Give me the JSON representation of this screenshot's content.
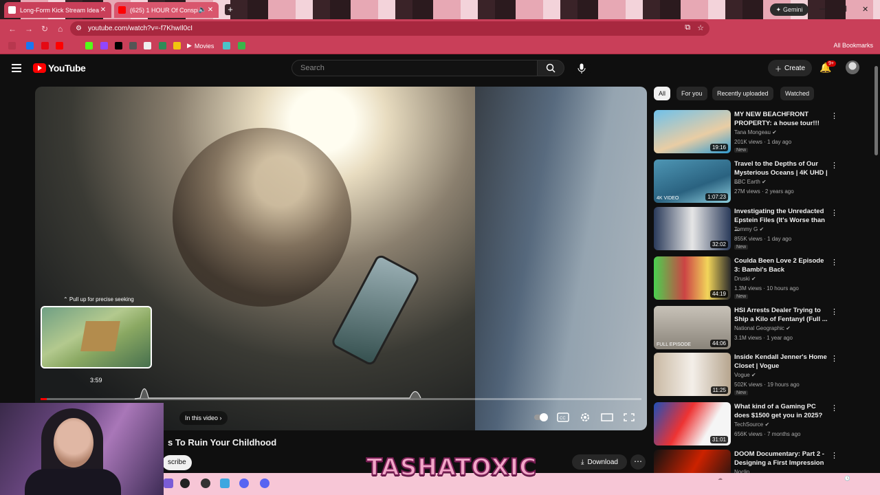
{
  "browser": {
    "tabs": [
      {
        "title": "Long-Form Kick Stream Ideas",
        "active": true
      },
      {
        "title": "(625) 1 HOUR Of Conspira",
        "active": false
      }
    ],
    "gemini_label": "Gemini",
    "url": "youtube.com/watch?v=-f7KhwIl0cI",
    "bookmarks": {
      "movies": "Movies",
      "all": "All Bookmarks"
    }
  },
  "youtube": {
    "logo_text": "YouTube",
    "search_placeholder": "Search",
    "create_label": "Create",
    "notif_badge": "9+"
  },
  "player": {
    "seek_hint": "⌃ Pull up for precise seeking",
    "preview_time": "3:59",
    "in_this_video": "In this video",
    "progress_fraction": 0.01
  },
  "below_video": {
    "title": "s To Ruin Your Childhood",
    "subscribe": "scribe",
    "download": "Download"
  },
  "chips": [
    "All",
    "For you",
    "Recently uploaded",
    "Watched"
  ],
  "recommendations": [
    {
      "title": "MY NEW BEACHFRONT PROPERTY: a house tour!!!",
      "channel": "Tana Mongeau",
      "meta": "201K views · 1 day ago",
      "new": "New",
      "duration": "19:16"
    },
    {
      "title": "Travel to the Depths of Our Mysterious Oceans | 4K UHD | ...",
      "channel": "BBC Earth",
      "meta": "27M views · 2 years ago",
      "duration": "1:07:23",
      "label": "4K VIDEO"
    },
    {
      "title": "Investigating the Unredacted Epstein Files (It's Worse than ...",
      "channel": "Tommy G",
      "meta": "855K views · 1 day ago",
      "new": "New",
      "duration": "32:02"
    },
    {
      "title": "Coulda Been Love 2 Episode 3: Bambi's Back",
      "channel": "Druski",
      "meta": "1.3M views · 10 hours ago",
      "new": "New",
      "duration": "44:19"
    },
    {
      "title": "HSI Arrests Dealer Trying to Ship a Kilo of Fentanyl (Full ...",
      "channel": "National Geographic",
      "meta": "3.1M views · 1 year ago",
      "duration": "44:06",
      "label": "FULL EPISODE"
    },
    {
      "title": "Inside Kendall Jenner's Home Closet | Vogue",
      "channel": "Vogue",
      "meta": "502K views · 19 hours ago",
      "new": "New",
      "duration": "11:25"
    },
    {
      "title": "What kind of a Gaming PC does $1500 get you in 2025?",
      "channel": "TechSource",
      "meta": "656K views · 7 months ago",
      "duration": "31:01"
    },
    {
      "title": "DOOM Documentary: Part 2 - Designing a First Impression",
      "channel": "Noclip",
      "meta": "",
      "duration": ""
    }
  ],
  "overlay": {
    "brand": "TASHATOXIC"
  },
  "colors": {
    "accent": "#c93f59",
    "yt_red": "#ff0000",
    "bg": "#0f0f0f"
  }
}
